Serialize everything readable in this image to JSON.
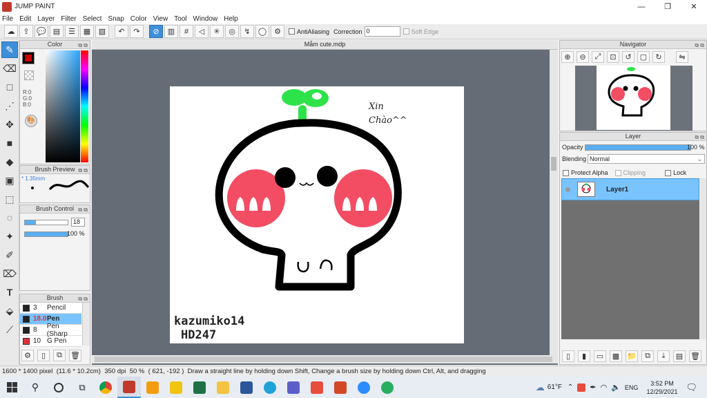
{
  "window": {
    "title": "JUMP PAINT",
    "minimize": "—",
    "restore": "❐",
    "close": "✕"
  },
  "menu": [
    "File",
    "Edit",
    "Layer",
    "Filter",
    "Select",
    "Snap",
    "Color",
    "View",
    "Tool",
    "Window",
    "Help"
  ],
  "toolbar": {
    "antialias_label": "AntiAliasing",
    "correction_label": "Correction",
    "correction_value": "0",
    "soft_edge_label": "Soft Edge"
  },
  "color_panel": {
    "title": "Color",
    "r": "R:0",
    "g": "G:0",
    "b": "B:0",
    "fg_color": "#000000"
  },
  "brush_preview": {
    "title": "Brush Preview",
    "size": "* 1.35mm"
  },
  "brush_control": {
    "title": "Brush Control",
    "size_value": "18",
    "opacity_value": "100 %",
    "size_fraction": 0.25,
    "opacity_fraction": 1.0
  },
  "brush_panel": {
    "title": "Brush",
    "items": [
      {
        "size": "3",
        "name": "Pencil",
        "color": "#222222"
      },
      {
        "size": "18.0",
        "name": "Pen",
        "color": "#222222"
      },
      {
        "size": "8",
        "name": "Pen (Sharp",
        "color": "#222222"
      },
      {
        "size": "10",
        "name": "G Pen",
        "color": "#e0303a"
      }
    ]
  },
  "document": {
    "tab": "Mẫm cute.mdp"
  },
  "artwork": {
    "caption_top": "Xin",
    "caption_top2": "Chào^^",
    "sign1": "kazumiko14",
    "sign2": "HD247",
    "mouth": "ᴗ",
    "belly": "u n"
  },
  "navigator": {
    "title": "Navigator"
  },
  "layer_panel": {
    "title": "Layer",
    "opacity_label": "Opacity",
    "opacity_value": "100 %",
    "opacity_fraction": 1.0,
    "blending_label": "Blending",
    "blending_value": "Normal",
    "protect_alpha": "Protect Alpha",
    "clipping": "Clipping",
    "lock": "Lock",
    "layers": [
      {
        "name": "Layer1"
      }
    ]
  },
  "status": {
    "size": "1600 * 1400 pixel",
    "cm": "(11.6 * 10.2cm)",
    "dpi": "350 dpi",
    "zoom": "50 %",
    "coords": "( 621, -192 )",
    "hint": "Draw a straight line by holding down Shift, Change a brush size by holding down Ctrl, Alt, and dragging"
  },
  "taskbar": {
    "weather": "61°F",
    "lang": "ENG",
    "time": "3:52 PM",
    "date": "12/29/2021"
  }
}
